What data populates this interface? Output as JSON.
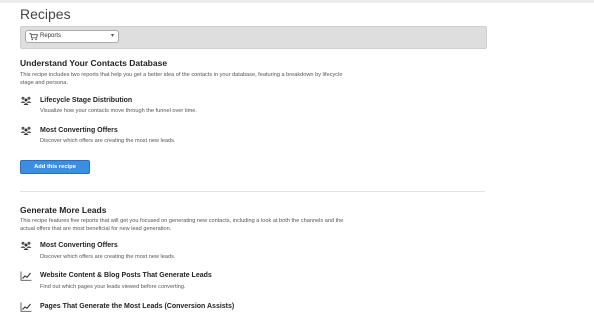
{
  "page": {
    "title": "Recipes"
  },
  "filter": {
    "selected": "Reports",
    "icon": "cart-icon"
  },
  "sections": [
    {
      "title": "Understand Your Contacts Database",
      "description": "This recipe includes two reports that help you get a better idea of the contacts in your database, featuring a breakdown by lifecycle stage and persona.",
      "items": [
        {
          "icon": "people-icon",
          "title": "Lifecycle Stage Distribution",
          "description": "Visualize how your contacts move through the funnel over time."
        },
        {
          "icon": "people-icon",
          "title": "Most Converting Offers",
          "description": "Discover which offers are creating the most new leads."
        }
      ],
      "button_label": "Add this recipe"
    },
    {
      "title": "Generate More Leads",
      "description": "This recipe features five reports that will get you focused on generating new contacts, including a look at both the channels and the actual offers that are most beneficial for new lead generation.",
      "items": [
        {
          "icon": "people-icon",
          "title": "Most Converting Offers",
          "description": "Discover which offers are creating the most new leads."
        },
        {
          "icon": "line-chart-icon",
          "title": "Website Content & Blog Posts That Generate Leads",
          "description": "Find out which pages your leads viewed before converting."
        },
        {
          "icon": "line-chart-icon",
          "title": "Pages That Generate the Most Leads (Conversion Assists)",
          "description": ""
        }
      ]
    }
  ]
}
